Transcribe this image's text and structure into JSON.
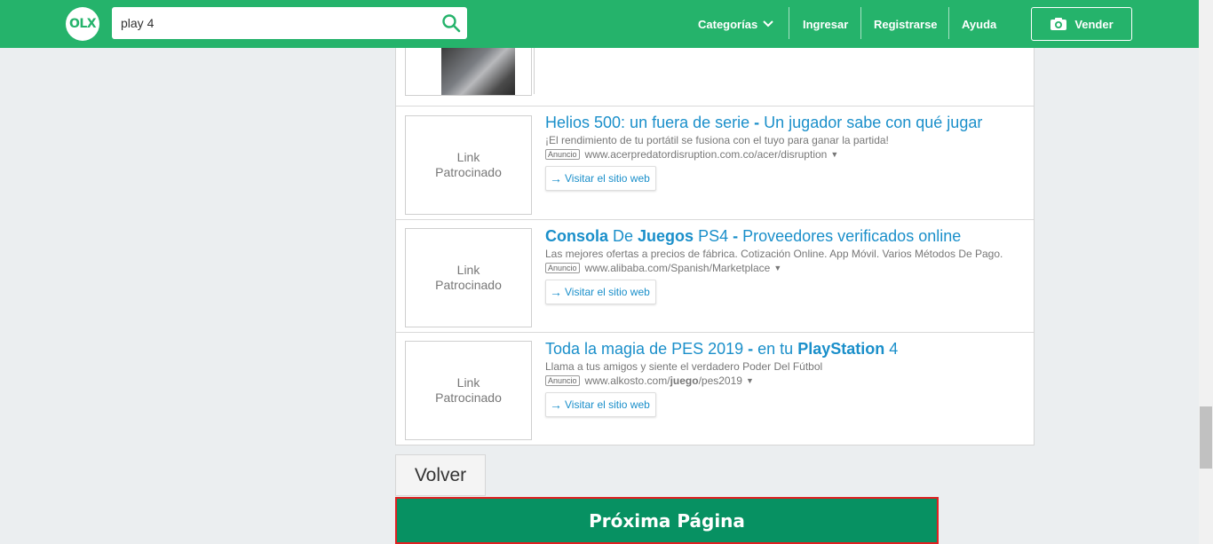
{
  "header": {
    "logo_text": "OLX",
    "search": {
      "value": "play 4"
    },
    "nav": {
      "categorias": "Categorías",
      "ingresar": "Ingresar",
      "registrarse": "Registrarse",
      "ayuda": "Ayuda"
    },
    "vender_label": "Vender",
    "brand_color": "#25b36b"
  },
  "ads": [
    {
      "title_parts": [
        {
          "text": "Helios 500: un fuera de serie ",
          "bold": false
        },
        {
          "text": "- ",
          "bold": true
        },
        {
          "text": "Un jugador sabe con qué jugar",
          "bold": false
        }
      ],
      "description": "¡El rendimiento de tu portátil se fusiona con el tuyo para ganar la partida!",
      "badge": "Anuncio",
      "url": "www.acerpredatordisruption.com.co/acer/disruption",
      "thumb": "Link Patrocinado",
      "visit_label": "Visitar el sitio web"
    },
    {
      "title_parts": [
        {
          "text": "Consola",
          "bold": true
        },
        {
          "text": " De ",
          "bold": false
        },
        {
          "text": "Juegos",
          "bold": true
        },
        {
          "text": " PS4 ",
          "bold": false
        },
        {
          "text": "- ",
          "bold": true
        },
        {
          "text": "Proveedores verificados online",
          "bold": false
        }
      ],
      "description": "Las mejores ofertas a precios de fábrica. Cotización Online. App Móvil. Varios Métodos De Pago.",
      "badge": "Anuncio",
      "url": "www.alibaba.com/Spanish/Marketplace",
      "thumb": "Link Patrocinado",
      "visit_label": "Visitar el sitio web"
    },
    {
      "title_parts": [
        {
          "text": "Toda la magia de PES 2019 ",
          "bold": false
        },
        {
          "text": "- ",
          "bold": true
        },
        {
          "text": "en tu ",
          "bold": false
        },
        {
          "text": "PlayStation",
          "bold": true
        },
        {
          "text": " 4",
          "bold": false
        }
      ],
      "description": "Llama a tus amigos y siente el verdadero Poder Del Fútbol",
      "badge": "Anuncio",
      "url_parts": [
        {
          "text": "www.alkosto.com/",
          "bold": false
        },
        {
          "text": "juego",
          "bold": true
        },
        {
          "text": "/pes2019",
          "bold": false
        }
      ],
      "thumb": "Link Patrocinado",
      "visit_label": "Visitar el sitio web"
    }
  ],
  "pager": {
    "volver": "Volver",
    "proxima": "Próxima Página"
  }
}
